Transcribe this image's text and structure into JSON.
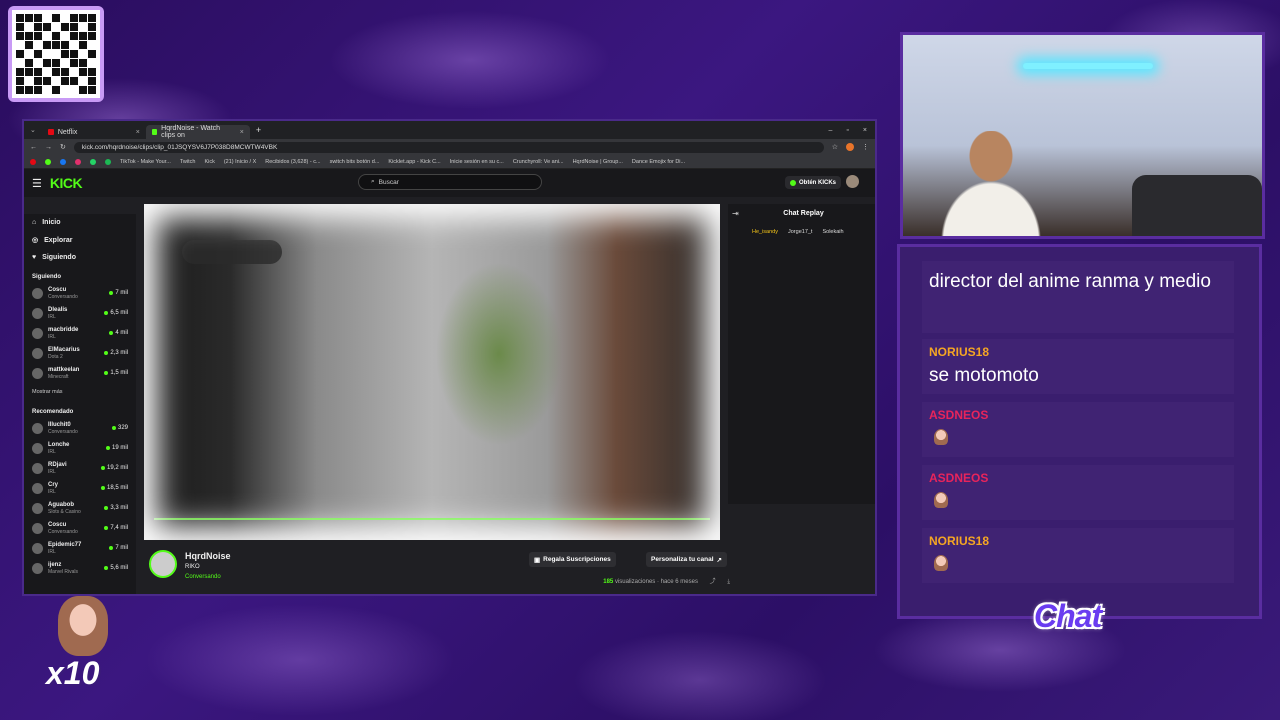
{
  "browser": {
    "tabs": [
      {
        "label": "Netflix",
        "color": "#e50914"
      },
      {
        "label": "HqrdNoise - Watch clips on",
        "color": "#53fc18"
      }
    ],
    "url": "kick.com/hqrdnoise/clips/clip_01JSQYSV6J7P038D8MCWTW4VBK",
    "bookmarks": [
      "TikTok - Make Your...",
      "Twitch",
      "Kick",
      "(21) Inicio / X",
      "Recibidos (3,628) - c...",
      "switch bits botón d...",
      "Kicklet.app - Kick C...",
      "Inicie sesión en su c...",
      "Crunchyroll: Ve ani...",
      "HqrdNoise | Group...",
      "Dance Emojix for Di..."
    ]
  },
  "kick": {
    "logo": "KICK",
    "search_placeholder": "Buscar",
    "get_kicks": "Obtén KICKs",
    "nav": [
      {
        "label": "Inicio",
        "icon": "home-icon"
      },
      {
        "label": "Explorar",
        "icon": "compass-icon"
      },
      {
        "label": "Siguiendo",
        "icon": "heart-icon"
      }
    ],
    "following_title": "Siguiendo",
    "following": [
      {
        "name": "Coscu",
        "game": "Conversando",
        "viewers": "7 mil"
      },
      {
        "name": "Dlealis",
        "game": "IRL",
        "viewers": "6,5 mil"
      },
      {
        "name": "macbridde",
        "game": "IRL",
        "viewers": "4 mil"
      },
      {
        "name": "ElMacarius",
        "game": "Dota 2",
        "viewers": "2,3 mil"
      },
      {
        "name": "mattkeelan",
        "game": "Minecraft",
        "viewers": "1,5 mil"
      }
    ],
    "show_more": "Mostrar más",
    "recommended_title": "Recomendado",
    "recommended": [
      {
        "name": "Illuchit0",
        "game": "Conversando",
        "viewers": "329"
      },
      {
        "name": "Lonche",
        "game": "IRL",
        "viewers": "19 mil"
      },
      {
        "name": "RDjavi",
        "game": "IRL",
        "viewers": "19,2 mil"
      },
      {
        "name": "Cry",
        "game": "IRL",
        "viewers": "18,5 mil"
      },
      {
        "name": "Aguabob",
        "game": "Slots & Casino",
        "viewers": "3,3 mil"
      },
      {
        "name": "Coscu",
        "game": "Conversando",
        "viewers": "7,4 mil"
      },
      {
        "name": "Epidemic77",
        "game": "IRL",
        "viewers": "7 mil"
      },
      {
        "name": "ijenz",
        "game": "Marvel Rivals",
        "viewers": "5,6 mil"
      }
    ],
    "chat_replay_title": "Chat Replay",
    "chat_users": [
      "He_isandy",
      "Jorge17_t",
      "Solekaih"
    ],
    "channel": {
      "name": "HqrdNoise",
      "subtitle": "RIKO",
      "category": "Conversando",
      "gift_button": "Regala Suscripciones",
      "customize_button": "Personaliza tu canal",
      "views_count": "185",
      "views_label": "visualizaciones · hace 6 meses"
    }
  },
  "overlay": {
    "chat": [
      {
        "user": "",
        "text": "director del anime ranma y medio",
        "color": "#ffffff"
      },
      {
        "user": "NORIUS18",
        "text": "se motomoto",
        "color": "#f5a623"
      },
      {
        "user": "ASDNEOS",
        "text": "",
        "color": "#e8245b"
      },
      {
        "user": "ASDNEOS",
        "text": "",
        "color": "#e8245b"
      },
      {
        "user": "NORIUS18",
        "text": "",
        "color": "#f5a623"
      }
    ],
    "chat_label": "Chat",
    "multiplier": "x10"
  }
}
